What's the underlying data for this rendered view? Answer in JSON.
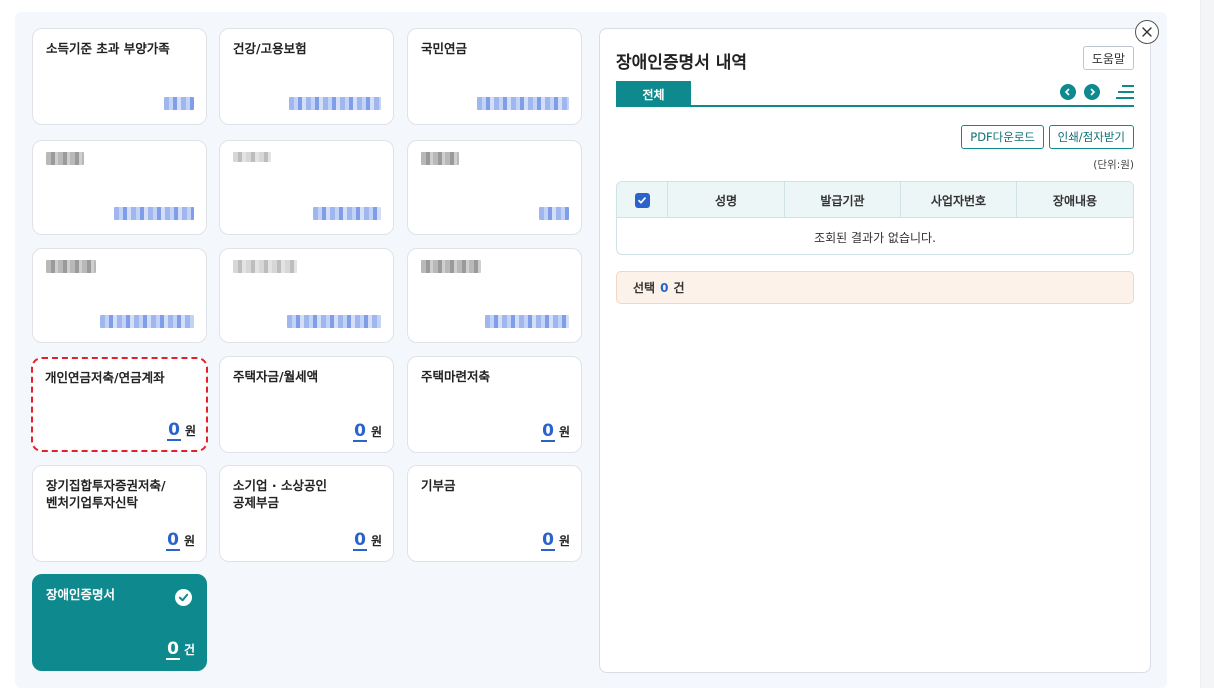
{
  "cards": [
    {
      "title": "소득기준 초과 부양가족"
    },
    {
      "title": "건강/고용보험"
    },
    {
      "title": "국민연금"
    },
    {
      "title": "개인연금저축/연금계좌",
      "amount": "0",
      "unit": "원"
    },
    {
      "title": "주택자금/월세액",
      "amount": "0",
      "unit": "원"
    },
    {
      "title": "주택마련저축",
      "amount": "0",
      "unit": "원"
    },
    {
      "title_line1": "장기집합투자증권저축/",
      "title_line2": "벤처기업투자신탁",
      "amount": "0",
      "unit": "원"
    },
    {
      "title_line1": "소기업 · 소상공인",
      "title_line2": "공제부금",
      "amount": "0",
      "unit": "원"
    },
    {
      "title": "기부금",
      "amount": "0",
      "unit": "원"
    },
    {
      "title": "장애인증명서",
      "amount": "0",
      "unit": "건",
      "check_icon": "check-circle-icon"
    }
  ],
  "panel": {
    "title": "장애인증명서 내역",
    "help_label": "도움말",
    "close_icon": "close-icon",
    "tabs": [
      {
        "label": "전체",
        "active": true
      }
    ],
    "prev_icon": "chevron-left-icon",
    "next_icon": "chevron-right-icon",
    "menu_icon": "menu-icon",
    "pdf_button": "PDF다운로드",
    "print_button": "인쇄/점자받기",
    "unit_note": "(단위:원)",
    "table": {
      "headers": [
        "성명",
        "발급기관",
        "사업자번호",
        "장애내용"
      ],
      "empty_message": "조회된 결과가 없습니다."
    },
    "summary": {
      "prefix": "선택",
      "count": "0",
      "suffix": "건"
    }
  },
  "colors": {
    "accent": "#0e8a8f",
    "highlight_blue": "#2a63c9",
    "selected_outline": "#e5202a",
    "summary_bg": "#fdf2e9"
  }
}
